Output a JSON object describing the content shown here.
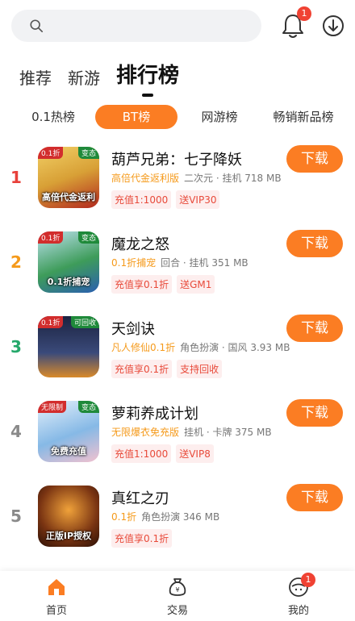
{
  "topbar": {
    "search_placeholder": "",
    "bell_badge": "1"
  },
  "main_tabs": [
    {
      "label": "推荐",
      "active": false
    },
    {
      "label": "新游",
      "active": false
    },
    {
      "label": "排行榜",
      "active": true
    }
  ],
  "sub_tabs": [
    {
      "label": "0.1热榜",
      "active": false
    },
    {
      "label": "BT榜",
      "active": true
    },
    {
      "label": "网游榜",
      "active": false
    },
    {
      "label": "畅销新品榜",
      "active": false
    }
  ],
  "games": [
    {
      "rank": "1",
      "rank_color": "#e8403a",
      "name": "葫芦兄弟：七子降妖",
      "highlight": "高倍代金返利版",
      "meta": "二次元 · 挂机  718 MB",
      "chips": [
        "充值1:1000",
        "送VIP30"
      ],
      "icon": {
        "bg": "#d8a036",
        "tag": "0.1折",
        "tag2": "变态",
        "banner": "高倍代金返利"
      },
      "button": "下载"
    },
    {
      "rank": "2",
      "rank_color": "#f59a1b",
      "name": "魔龙之怒",
      "highlight": "0.1折捕宠",
      "meta": "回合 · 挂机  351 MB",
      "chips": [
        "充值享0.1折",
        "送GM1"
      ],
      "icon": {
        "bg": "#3e9c5a",
        "tag": "0.1折",
        "tag2": "变态",
        "banner": "0.1折捕宠"
      },
      "button": "下载"
    },
    {
      "rank": "3",
      "rank_color": "#25a86b",
      "name": "天剑诀",
      "highlight": "凡人修仙0.1折",
      "meta": "角色扮演 · 国风  3.93 MB",
      "chips": [
        "充值享0.1折",
        "支持回收"
      ],
      "icon": {
        "bg": "#2b3350",
        "tag": "0.1折",
        "tag2": "可回收",
        "banner": ""
      },
      "button": "下载"
    },
    {
      "rank": "4",
      "rank_color": "#8a8a8a",
      "name": "萝莉养成计划",
      "highlight": "无限爆衣免充版",
      "meta": "挂机 · 卡牌  375 MB",
      "chips": [
        "充值1:1000",
        "送VIP8"
      ],
      "icon": {
        "bg": "#86b9e6",
        "tag": "无限制",
        "tag2": "变态",
        "banner": "免费充值"
      },
      "button": "下载"
    },
    {
      "rank": "5",
      "rank_color": "#8a8a8a",
      "name": "真红之刃",
      "highlight": "0.1折",
      "meta": "角色扮演  346 MB",
      "chips": [
        "充值享0.1折"
      ],
      "icon": {
        "bg": "#7a3412",
        "tag": "",
        "tag2": "",
        "banner": "正版IP授权"
      },
      "button": "下载"
    }
  ],
  "bottom_nav": [
    {
      "label": "首页",
      "icon": "home-icon",
      "active": true
    },
    {
      "label": "交易",
      "icon": "money-bag-icon",
      "active": false
    },
    {
      "label": "我的",
      "icon": "profile-icon",
      "active": false,
      "badge": "1"
    }
  ]
}
